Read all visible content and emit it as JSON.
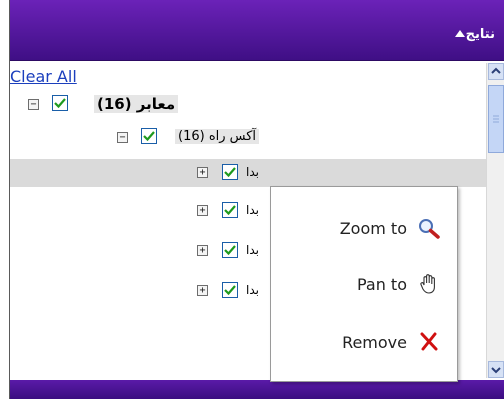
{
  "header": {
    "title": "نتایج"
  },
  "tree": {
    "clear_all": "Clear All",
    "root": {
      "label": "(معابر (16",
      "collapse_symbol": "−"
    },
    "child": {
      "label": "(آکس راه (16",
      "collapse_symbol": "−"
    },
    "leaves": [
      {
        "label": "بدا",
        "expand_symbol": "+"
      },
      {
        "label": "بدا",
        "expand_symbol": "+"
      },
      {
        "label": "بدا",
        "expand_symbol": "+"
      },
      {
        "label": "بدا",
        "expand_symbol": "+"
      }
    ]
  },
  "context_menu": {
    "items": [
      {
        "label": "Zoom to",
        "icon": "magnifier-icon"
      },
      {
        "label": "Pan to",
        "icon": "hand-icon"
      },
      {
        "label": "Remove",
        "icon": "remove-x-icon"
      }
    ]
  },
  "colors": {
    "header_bg": "#4a148c",
    "link": "#1b3fbd",
    "checkbox_check": "#1e9a1e",
    "remove_red": "#d01010"
  }
}
